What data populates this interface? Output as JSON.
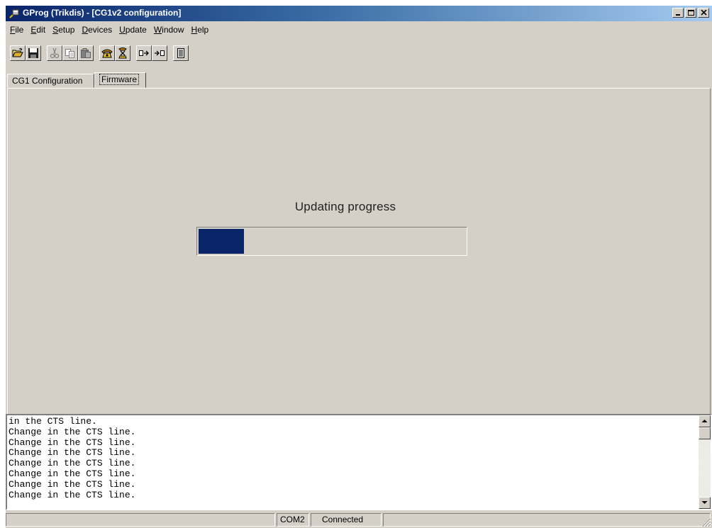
{
  "window": {
    "title": "GProg (Trikdis) - [CG1v2 configuration]"
  },
  "menu": [
    {
      "label": "File",
      "accel": "F",
      "rest": "ile"
    },
    {
      "label": "Edit",
      "accel": "E",
      "rest": "dit"
    },
    {
      "label": "Setup",
      "accel": "S",
      "rest": "etup"
    },
    {
      "label": "Devices",
      "accel": "D",
      "rest": "evices"
    },
    {
      "label": "Update",
      "accel": "U",
      "rest": "pdate"
    },
    {
      "label": "Window",
      "accel": "W",
      "rest": "indow"
    },
    {
      "label": "Help",
      "accel": "H",
      "rest": "elp"
    }
  ],
  "toolbar": {
    "icons": [
      "open-folder-icon",
      "save-icon",
      "cut-icon",
      "copy-icon",
      "paste-icon",
      "connect-phone-icon",
      "disconnect-icon",
      "read-device-icon",
      "write-device-icon",
      "log-icon"
    ]
  },
  "tabs": [
    {
      "label": "CG1 Configuration",
      "active": false
    },
    {
      "label": "Firmware",
      "active": true
    }
  ],
  "firmware": {
    "progress_label": "Updating progress",
    "progress_fraction": 0.17,
    "progress_color": "#0a246a"
  },
  "log": {
    "lines": [
      "in the CTS line.",
      "Change in the CTS line.",
      "Change in the CTS line.",
      "Change in the CTS line.",
      "Change in the CTS line.",
      "Change in the CTS line.",
      "Change in the CTS line.",
      "Change in the CTS line."
    ]
  },
  "status": {
    "port": "COM2",
    "connection": "Connected"
  },
  "colors": {
    "face": "#d4d0c8",
    "title_active": "#0a246a"
  }
}
